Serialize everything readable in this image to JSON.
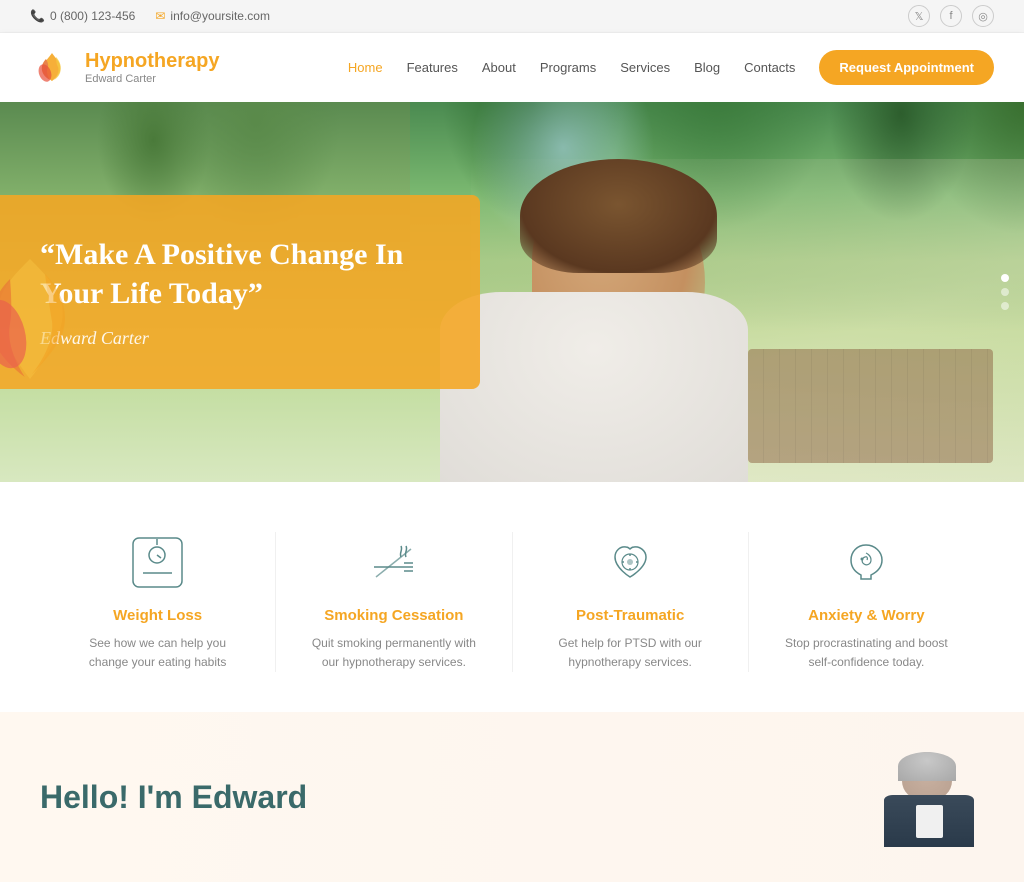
{
  "topbar": {
    "phone": "0 (800) 123-456",
    "email": "info@yoursite.com",
    "phone_icon": "📞",
    "email_icon": "✉"
  },
  "header": {
    "brand": "Hypnotherapy",
    "sub": "Edward Carter",
    "nav": [
      {
        "label": "Home",
        "active": true
      },
      {
        "label": "Features",
        "active": false
      },
      {
        "label": "About",
        "active": false
      },
      {
        "label": "Programs",
        "active": false
      },
      {
        "label": "Services",
        "active": false
      },
      {
        "label": "Blog",
        "active": false
      },
      {
        "label": "Contacts",
        "active": false
      }
    ],
    "cta_button": "Request Appointment"
  },
  "hero": {
    "quote": "“Make A Positive Change In Your Life Today”",
    "author": "Edward Carter",
    "dots": [
      true,
      false,
      false
    ]
  },
  "services": [
    {
      "id": "weight-loss",
      "title": "Weight Loss",
      "desc": "See how we can help you change your eating habits",
      "icon": "scale"
    },
    {
      "id": "smoking-cessation",
      "title": "Smoking Cessation",
      "desc": "Quit smoking permanently with our hypnotherapy services.",
      "icon": "no-smoking"
    },
    {
      "id": "post-traumatic",
      "title": "Post-Traumatic",
      "desc": "Get help for PTSD with our hypnotherapy services.",
      "icon": "heart-person"
    },
    {
      "id": "anxiety-worry",
      "title": "Anxiety & Worry",
      "desc": "Stop procrastinating and boost self-confidence today.",
      "icon": "head-mind"
    }
  ],
  "bottom": {
    "title": "Hello! I'm Edward"
  },
  "social": [
    "twitter",
    "facebook",
    "instagram"
  ],
  "colors": {
    "primary": "#f5a623",
    "text_dark": "#3a3a3a",
    "text_medium": "#666666",
    "text_light": "#888888",
    "accent_teal": "#3a6a6a"
  }
}
